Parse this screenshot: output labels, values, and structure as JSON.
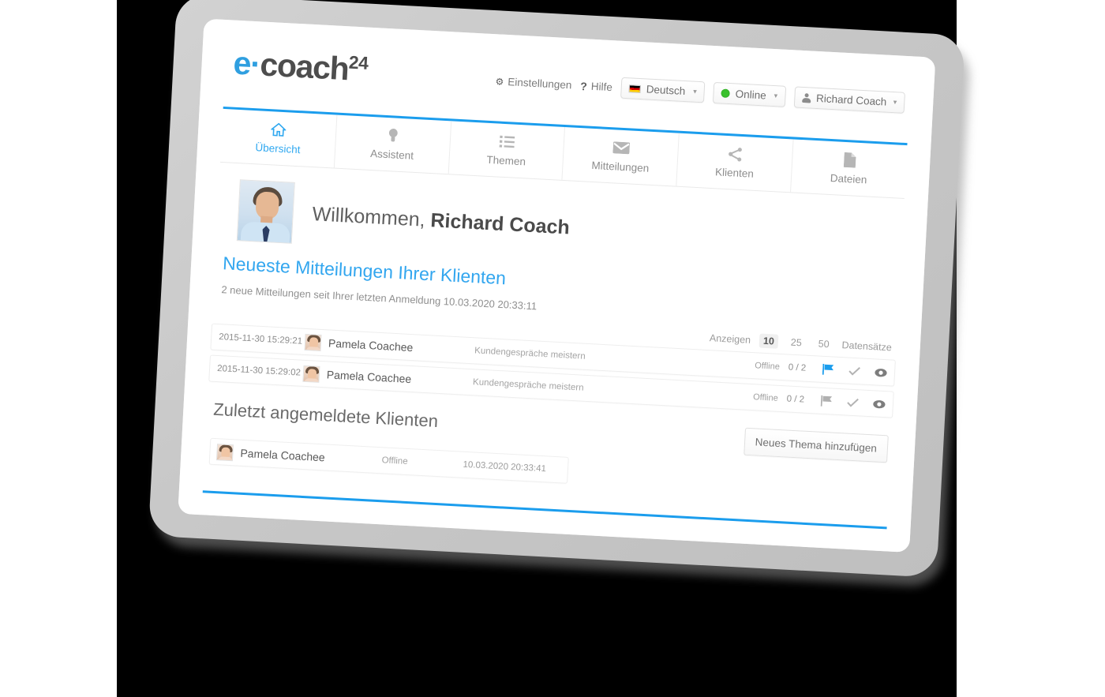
{
  "brand": {
    "name_part1": "e",
    "separator": "·",
    "name_part2": "coach",
    "superscript": "24",
    "accent_color": "#1b9ded",
    "logo_blue": "#2f9fe0",
    "logo_gray": "#4d4d4d"
  },
  "header": {
    "settings_label": "Einstellungen",
    "settings_icon": "gear-icon",
    "help_label": "Hilfe",
    "help_icon": "question-mark-icon",
    "language": {
      "label": "Deutsch",
      "flag": "german-flag-icon",
      "caret": "▾"
    },
    "status": {
      "label": "Online",
      "dot_color": "#39c12c",
      "caret": "▾"
    },
    "user": {
      "label": "Richard Coach",
      "icon": "person-icon",
      "caret": "▾"
    }
  },
  "tabs": [
    {
      "label": "Übersicht",
      "icon": "home-icon",
      "active": true
    },
    {
      "label": "Assistent",
      "icon": "bulb-icon",
      "active": false
    },
    {
      "label": "Themen",
      "icon": "list-icon",
      "active": false
    },
    {
      "label": "Mitteilungen",
      "icon": "envelope-icon",
      "active": false
    },
    {
      "label": "Klienten",
      "icon": "share-icon",
      "active": false
    },
    {
      "label": "Dateien",
      "icon": "file-icon",
      "active": false
    }
  ],
  "welcome": {
    "greeting": "Willkommen,",
    "user_name": "Richard Coach",
    "avatar": "coach-avatar-photo"
  },
  "messages_section": {
    "title": "Neueste Mitteilungen Ihrer Klienten",
    "subtitle": "2 neue Mitteilungen seit Ihrer letzten Anmeldung 10.03.2020 20:33:11",
    "paging": {
      "prefix": "Anzeigen",
      "options": [
        "10",
        "25",
        "50"
      ],
      "selected": "10",
      "suffix": "Datensätze"
    },
    "rows": [
      {
        "date": "2015-11-30 15:29:21",
        "name": "Pamela Coachee",
        "avatar": "client-avatar-photo",
        "topic": "Kundengespräche meistern",
        "status": "Offline",
        "count": "0 / 2",
        "flag_icon": "flag-icon",
        "flag_color": "#1b9ded",
        "check_icon": "check-icon",
        "eye_icon": "eye-icon"
      },
      {
        "date": "2015-11-30 15:29:02",
        "name": "Pamela Coachee",
        "avatar": "client-avatar-photo",
        "topic": "Kundengespräche meistern",
        "status": "Offline",
        "count": "0 / 2",
        "flag_icon": "flag-icon",
        "flag_color": "#b0b0b0",
        "check_icon": "check-icon",
        "eye_icon": "eye-icon"
      }
    ]
  },
  "clients_section": {
    "title": "Zuletzt angemeldete Klienten",
    "add_button": "Neues Thema hinzufügen",
    "rows": [
      {
        "name": "Pamela Coachee",
        "avatar": "client-avatar-photo",
        "status": "Offline",
        "time": "10.03.2020 20:33:41"
      }
    ]
  }
}
